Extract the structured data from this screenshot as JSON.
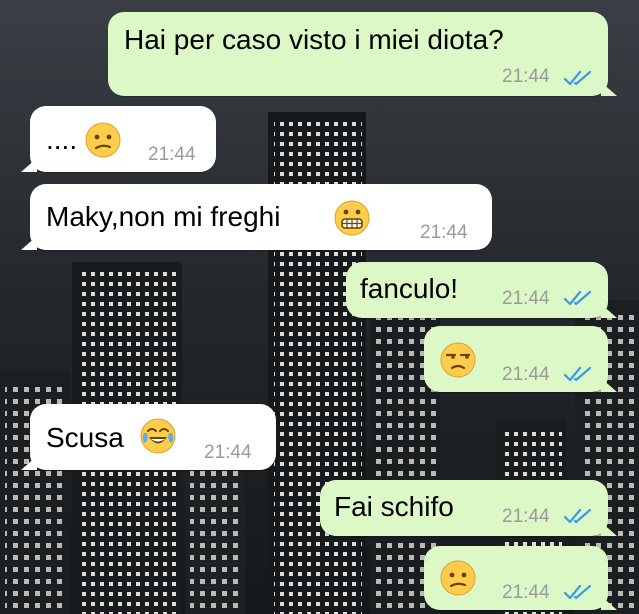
{
  "messages": [
    {
      "direction": "outgoing",
      "text": "Hai per caso visto i miei diota?",
      "emoji": "",
      "time": "21:44",
      "status": "read"
    },
    {
      "direction": "incoming",
      "text": "....",
      "emoji": "confused-face",
      "time": "21:44"
    },
    {
      "direction": "incoming",
      "text": "Maky,non mi freghi",
      "emoji": "grimacing-face",
      "time": "21:44"
    },
    {
      "direction": "outgoing",
      "text": "fanculo!",
      "emoji": "",
      "time": "21:44",
      "status": "read"
    },
    {
      "direction": "outgoing",
      "text": "",
      "emoji": "unamused-face",
      "time": "21:44",
      "status": "read"
    },
    {
      "direction": "incoming",
      "text": "Scusa",
      "emoji": "tears-of-joy-face",
      "time": "21:44"
    },
    {
      "direction": "outgoing",
      "text": "Fai schifo",
      "emoji": "",
      "time": "21:44",
      "status": "read"
    },
    {
      "direction": "outgoing",
      "text": "",
      "emoji": "confused-face",
      "time": "21:44",
      "status": "read"
    }
  ],
  "colors": {
    "outgoing_bubble": "#dcf8c6",
    "incoming_bubble": "#ffffff",
    "timestamp": "#9a9a9a",
    "read_ticks": "#3b9ae8",
    "wallpaper": "#2a2d31"
  }
}
